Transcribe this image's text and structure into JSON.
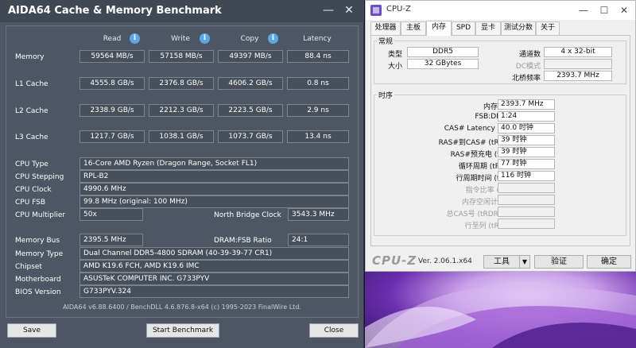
{
  "aida": {
    "title": "AIDA64 Cache & Memory Benchmark",
    "minimize": "—",
    "close": "✕",
    "columns": {
      "read": "Read",
      "write": "Write",
      "copy": "Copy",
      "latency": "Latency"
    },
    "bench_rows": [
      {
        "label": "Memory",
        "read": "59564 MB/s",
        "write": "57158 MB/s",
        "copy": "49397 MB/s",
        "latency": "88.4 ns"
      },
      {
        "label": "L1 Cache",
        "read": "4555.8 GB/s",
        "write": "2376.8 GB/s",
        "copy": "4606.2 GB/s",
        "latency": "0.8 ns"
      },
      {
        "label": "L2 Cache",
        "read": "2338.9 GB/s",
        "write": "2212.3 GB/s",
        "copy": "2223.5 GB/s",
        "latency": "2.9 ns"
      },
      {
        "label": "L3 Cache",
        "read": "1217.7 GB/s",
        "write": "1038.1 GB/s",
        "copy": "1073.7 GB/s",
        "latency": "13.4 ns"
      }
    ],
    "cpu": {
      "type_label": "CPU Type",
      "type": "16-Core AMD Ryzen  (Dragon Range, Socket FL1)",
      "stepping_label": "CPU Stepping",
      "stepping": "RPL-B2",
      "clock_label": "CPU Clock",
      "clock": "4990.6 MHz",
      "fsb_label": "CPU FSB",
      "fsb": "99.8 MHz  (original: 100 MHz)",
      "multiplier_label": "CPU Multiplier",
      "multiplier": "50x",
      "nb_clock_label": "North Bridge Clock",
      "nb_clock": "3543.3 MHz"
    },
    "system": {
      "bus_label": "Memory Bus",
      "bus": "2395.5 MHz",
      "ratio_label": "DRAM:FSB Ratio",
      "ratio": "24:1",
      "memtype_label": "Memory Type",
      "memtype": "Dual Channel DDR5-4800 SDRAM  (40-39-39-77 CR1)",
      "chipset_label": "Chipset",
      "chipset": "AMD K19.6 FCH, AMD K19.6 IMC",
      "board_label": "Motherboard",
      "board": "ASUSTeK COMPUTER INC. G733PYV",
      "bios_label": "BIOS Version",
      "bios": "G733PYV.324"
    },
    "footer": "AIDA64 v6.88.6400 / BenchDLL 4.6.876.8-x64  (c) 1995-2023 FinalWire Ltd.",
    "buttons": {
      "save": "Save",
      "start": "Start Benchmark",
      "close": "Close"
    }
  },
  "cpuz": {
    "title": "CPU-Z",
    "minimize": "—",
    "maximize": "☐",
    "close": "✕",
    "tabs": [
      "处理器",
      "主板",
      "内存",
      "SPD",
      "显卡",
      "测试分数",
      "关于"
    ],
    "general": {
      "title": "常规",
      "type_label": "类型",
      "type": "DDR5",
      "size_label": "大小",
      "size": "32 GBytes",
      "channels_label": "通道数",
      "channels": "4 x 32-bit",
      "dc_label": "DC模式",
      "dc": "",
      "nb_label": "北桥频率",
      "nb": "2393.7 MHz"
    },
    "timings": {
      "title": "时序",
      "rows": [
        {
          "label": "内存频率",
          "value": "2393.7 MHz",
          "dim": false
        },
        {
          "label": "FSB:DRAM",
          "value": "1:24",
          "dim": false
        },
        {
          "label": "CAS# Latency (CL)",
          "value": "40.0 时钟",
          "dim": false
        },
        {
          "label": "RAS#到CAS# (tRCD)",
          "value": "39 时钟",
          "dim": false
        },
        {
          "label": "RAS#预充电 (tRP)",
          "value": "39 时钟",
          "dim": false
        },
        {
          "label": "循环周期 (tRAS)",
          "value": "77 时钟",
          "dim": false
        },
        {
          "label": "行周期时间 (tRC)",
          "value": "116 时钟",
          "dim": false
        },
        {
          "label": "指令比率 (CR)",
          "value": "",
          "dim": true
        },
        {
          "label": "内存空闲计时器",
          "value": "",
          "dim": true
        },
        {
          "label": "总CAS号 (tRDRAM)",
          "value": "",
          "dim": true
        },
        {
          "label": "行至列 (tRCD)",
          "value": "",
          "dim": true
        }
      ]
    },
    "logo": "CPU-Z",
    "version": "Ver. 2.06.1.x64",
    "buttons": {
      "tools": "工具",
      "tools_arrow": "▼",
      "validate": "验证",
      "ok": "确定"
    }
  }
}
